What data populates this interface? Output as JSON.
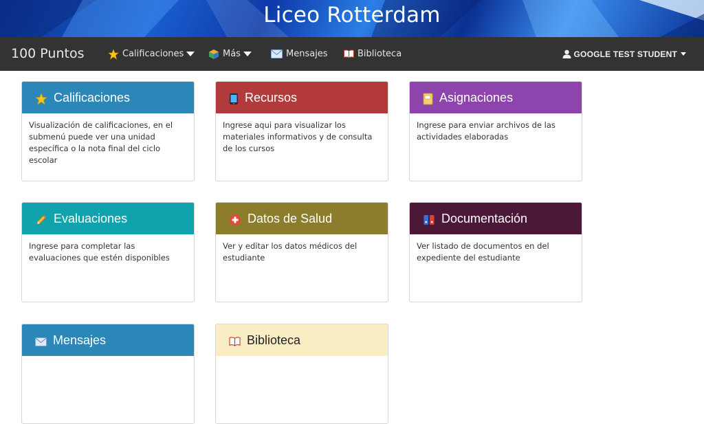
{
  "banner": {
    "title": "Liceo Rotterdam"
  },
  "navbar": {
    "brand": "100 Puntos",
    "items": [
      {
        "label": "Calificaciones",
        "icon": "star-icon",
        "has_dropdown": true
      },
      {
        "label": "Más",
        "icon": "cube-icon",
        "has_dropdown": true
      },
      {
        "label": "Mensajes",
        "icon": "envelope-icon",
        "has_dropdown": false
      },
      {
        "label": "Biblioteca",
        "icon": "book-icon",
        "has_dropdown": false
      }
    ],
    "user": {
      "name": "GOOGLE TEST STUDENT",
      "icon": "user-icon"
    }
  },
  "cards": [
    {
      "title": "Calificaciones",
      "icon": "star-icon",
      "color": "#2a87b8",
      "description": "Visualización de calificaciones, en el submenú puede ver una unidad específica o la nota final del ciclo escolar"
    },
    {
      "title": "Recursos",
      "icon": "tablet-icon",
      "color": "#b33a3a",
      "description": "Ingrese aqui para visualizar los materiales informativos y de consulta de los cursos"
    },
    {
      "title": "Asignaciones",
      "icon": "notebook-icon",
      "color": "#8e44ad",
      "description": "Ingrese para enviar archivos de las actividades elaboradas"
    },
    {
      "title": "Evaluaciones",
      "icon": "pencil-icon",
      "color": "#10a3ae",
      "description": "Ingrese para completar las evaluaciones que estén disponibles"
    },
    {
      "title": "Datos de Salud",
      "icon": "first-aid-icon",
      "color": "#8b7d2b",
      "description": "Ver y editar los datos médicos del estudiante"
    },
    {
      "title": "Documentación",
      "icon": "binders-icon",
      "color": "#4c1838",
      "description": "Ver listado de documentos en del expediente del estudiante"
    },
    {
      "title": "Mensajes",
      "icon": "envelope-icon",
      "color": "#2a87b8",
      "description": ""
    },
    {
      "title": "Biblioteca",
      "icon": "book-icon",
      "color": "#f9edc4",
      "description": ""
    }
  ]
}
